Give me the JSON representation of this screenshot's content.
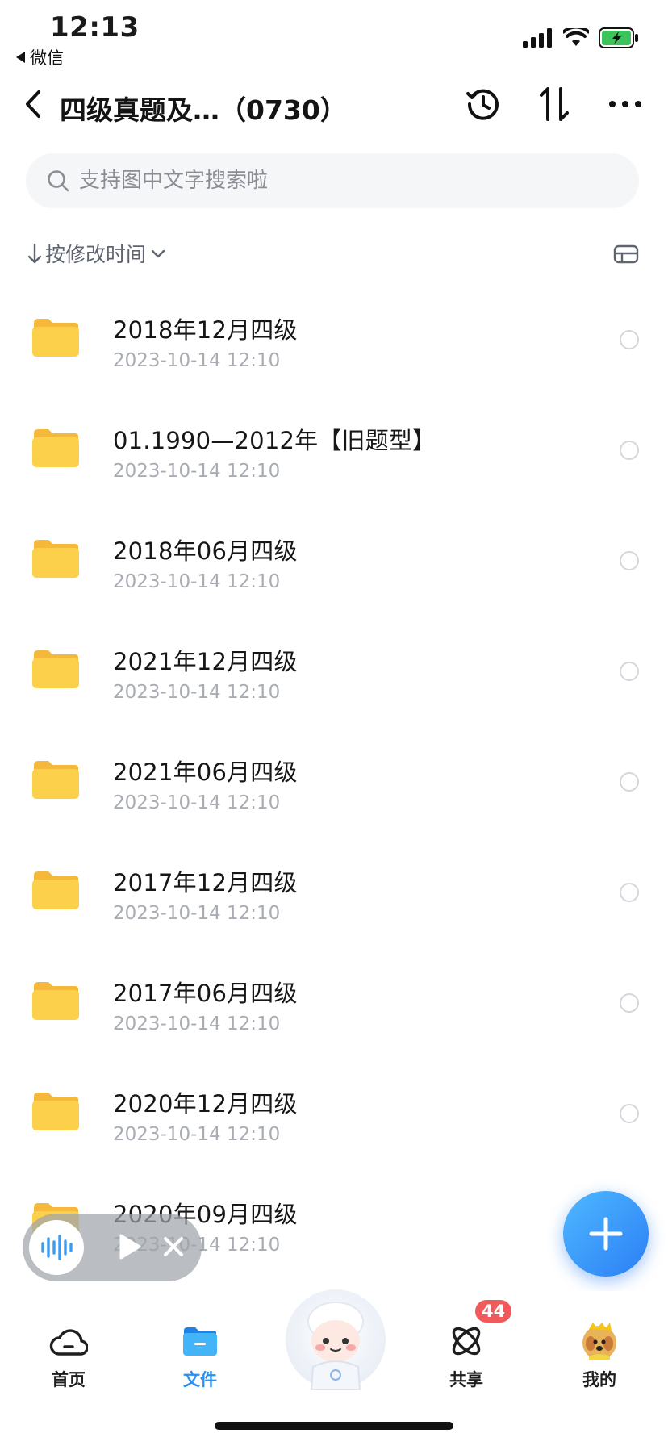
{
  "status_bar": {
    "time": "12:13",
    "back_app": "微信"
  },
  "nav": {
    "title": "四级真题及…（0730）"
  },
  "search": {
    "placeholder": "支持图中文字搜索啦"
  },
  "sort": {
    "label": "按修改时间"
  },
  "files": [
    {
      "name": "2018年12月四级",
      "date": "2023-10-14 12:10"
    },
    {
      "name": "01.1990—2012年【旧题型】",
      "date": "2023-10-14 12:10"
    },
    {
      "name": "2018年06月四级",
      "date": "2023-10-14 12:10"
    },
    {
      "name": "2021年12月四级",
      "date": "2023-10-14 12:10"
    },
    {
      "name": "2021年06月四级",
      "date": "2023-10-14 12:10"
    },
    {
      "name": "2017年12月四级",
      "date": "2023-10-14 12:10"
    },
    {
      "name": "2017年06月四级",
      "date": "2023-10-14 12:10"
    },
    {
      "name": "2020年12月四级",
      "date": "2023-10-14 12:10"
    },
    {
      "name": "2020年09月四级",
      "date": "2023-10-14 12:10"
    }
  ],
  "tabs": [
    {
      "label": "首页",
      "icon": "cloud-icon"
    },
    {
      "label": "文件",
      "icon": "folder-icon",
      "active": true
    },
    {
      "label": "",
      "icon": "mascot-avatar"
    },
    {
      "label": "共享",
      "icon": "share-orbit-icon",
      "badge": "44"
    },
    {
      "label": "我的",
      "icon": "avatar-dog"
    }
  ],
  "colors": {
    "accent": "#2c8ff0",
    "folder": "#fcd04a",
    "badge": "#f15a5a",
    "date_text": "#a9adb3"
  }
}
